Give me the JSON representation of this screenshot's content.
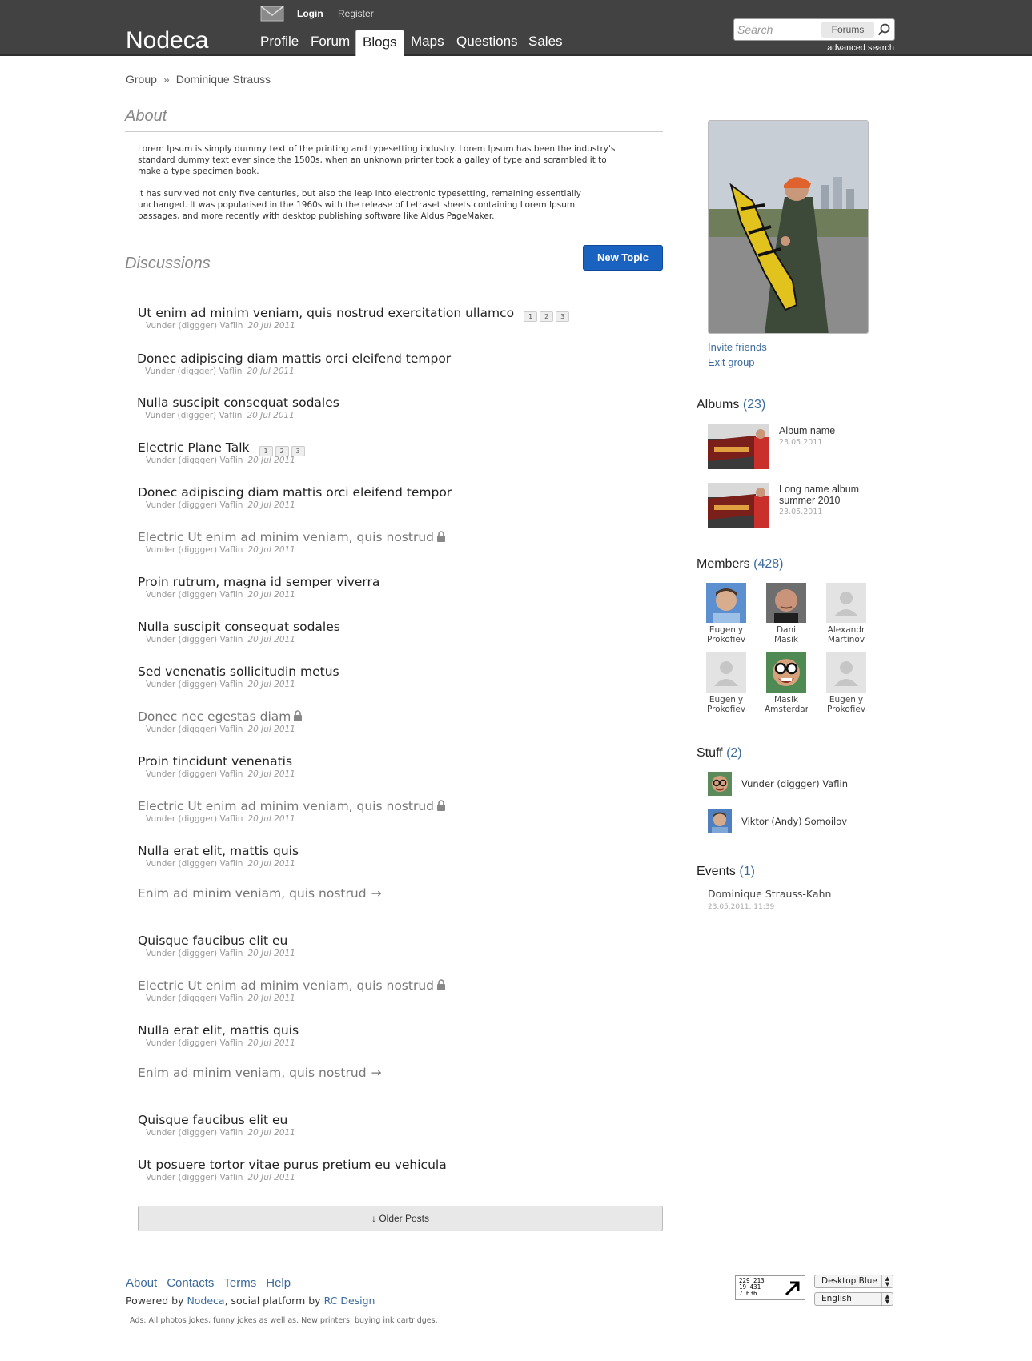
{
  "header": {
    "logo": "Nodeca",
    "login": "Login",
    "register": "Register",
    "nav": [
      "Profile",
      "Forum",
      "Blogs",
      "Maps",
      "Questions",
      "Sales"
    ],
    "active_nav": "Blogs",
    "search_placeholder": "Search",
    "search_scope": "Forums",
    "advanced_search": "advanced search"
  },
  "breadcrumb": {
    "group": "Group",
    "sep": "»",
    "current": "Dominique Strauss"
  },
  "about": {
    "title": "About",
    "p1": "Lorem Ipsum is simply dummy text of the printing and typesetting industry. Lorem Ipsum has been the industry's standard dummy text ever since the 1500s, when an unknown printer took a galley of type and scrambled it to make a type specimen book.",
    "p2": "It has survived not only five centuries, but also the leap into electronic typesetting, remaining essentially unchanged. It was popularised in the 1960s with the release of Letraset sheets containing Lorem Ipsum passages, and more recently with desktop publishing software like Aldus PageMaker."
  },
  "discussions": {
    "title": "Discussions",
    "new_topic": "New Topic",
    "older_posts": "↓ Older Posts",
    "topics": [
      {
        "title": "Ut enim ad minim veniam, quis nostrud exercitation ullamco",
        "author": "Vunder (diggger) Vaflin",
        "date": "20 Jul 2011",
        "pages": [
          "1",
          "2",
          "3"
        ]
      },
      {
        "title": "Donec adipiscing diam mattis orci eleifend tempor",
        "author": "Vunder (diggger) Vaflin",
        "date": "20 Jul 2011"
      },
      {
        "title": "Nulla suscipit consequat sodales",
        "author": "Vunder (diggger) Vaflin",
        "date": "20 Jul 2011"
      },
      {
        "title": "Electric Plane Talk",
        "author": "Vunder (diggger) Vaflin",
        "date": "20 Jul 2011",
        "pages": [
          "1",
          "2",
          "3"
        ]
      },
      {
        "title": "Donec adipiscing diam mattis orci eleifend tempor",
        "author": "Vunder (diggger) Vaflin",
        "date": "20 Jul 2011"
      },
      {
        "title": "Electric Ut enim ad minim veniam, quis nostrud",
        "author": "Vunder (diggger) Vaflin",
        "date": "20 Jul 2011",
        "locked": true
      },
      {
        "title": "Proin rutrum, magna id semper viverra",
        "author": "Vunder (diggger) Vaflin",
        "date": "20 Jul 2011"
      },
      {
        "title": "Nulla suscipit consequat sodales",
        "author": "Vunder (diggger) Vaflin",
        "date": "20 Jul 2011"
      },
      {
        "title": "Sed venenatis sollicitudin metus",
        "author": "Vunder (diggger) Vaflin",
        "date": "20 Jul 2011"
      },
      {
        "title": "Donec nec egestas diam",
        "author": "Vunder (diggger) Vaflin",
        "date": "20 Jul 2011",
        "locked": true
      },
      {
        "title": "Proin tincidunt venenatis",
        "author": "Vunder (diggger) Vaflin",
        "date": "20 Jul 2011"
      },
      {
        "title": "Electric Ut enim ad minim veniam, quis nostrud",
        "author": "Vunder (diggger) Vaflin",
        "date": "20 Jul 2011",
        "locked": true
      },
      {
        "title": "Nulla erat elit, mattis quis",
        "author": "Vunder (diggger) Vaflin",
        "date": "20 Jul 2011"
      },
      {
        "title": "Enim ad minim veniam, quis nostrud",
        "moved": true
      },
      {
        "title": "Quisque faucibus elit eu",
        "author": "Vunder (diggger) Vaflin",
        "date": "20 Jul 2011"
      },
      {
        "title": "Electric Ut enim ad minim veniam, quis nostrud",
        "author": "Vunder (diggger) Vaflin",
        "date": "20 Jul 2011",
        "locked": true
      },
      {
        "title": "Nulla erat elit, mattis quis",
        "author": "Vunder (diggger) Vaflin",
        "date": "20 Jul 2011"
      },
      {
        "title": "Enim ad minim veniam, quis nostrud",
        "moved": true
      },
      {
        "title": "Quisque faucibus elit eu",
        "author": "Vunder (diggger) Vaflin",
        "date": "20 Jul 2011"
      },
      {
        "title": "Ut posuere tortor vitae purus pretium eu vehicula",
        "author": "Vunder (diggger) Vaflin",
        "date": "20 Jul 2011"
      }
    ]
  },
  "sidebar": {
    "invite": "Invite friends",
    "exit": "Exit group",
    "albums": {
      "title": "Albums",
      "count": "(23)",
      "items": [
        {
          "name": "Album name",
          "date": "23.05.2011"
        },
        {
          "name": "Long name album summer 2010",
          "date": "23.05.2011"
        }
      ]
    },
    "members": {
      "title": "Members",
      "count": "(428)",
      "items": [
        {
          "first": "Eugeniy",
          "last": "Prokofiev",
          "avatar": "face-1"
        },
        {
          "first": "Dani",
          "last": "Masik",
          "avatar": "face-2"
        },
        {
          "first": "Alexandr",
          "last": "Martinov",
          "avatar": "placeholder"
        },
        {
          "first": "Eugeniy",
          "last": "Prokofiev",
          "avatar": "placeholder"
        },
        {
          "first": "Masik",
          "last": "Amsterdam",
          "avatar": "face-3"
        },
        {
          "first": "Eugeniy",
          "last": "Prokofiev",
          "avatar": "placeholder"
        }
      ]
    },
    "stuff": {
      "title": "Stuff",
      "count": "(2)",
      "items": [
        {
          "name": "Vunder (diggger) Vaflin"
        },
        {
          "name": "Viktor (Andy) Somoilov"
        }
      ]
    },
    "events": {
      "title": "Events",
      "count": "(1)",
      "items": [
        {
          "name": "Dominique Strauss-Kahn",
          "date": "23.05.2011, 11:39"
        }
      ]
    }
  },
  "footer": {
    "links": [
      "About",
      "Contacts",
      "Terms",
      "Help"
    ],
    "powered_prefix": "Powered by",
    "powered_site": "Nodeca",
    "powered_mid": ", social platform by",
    "powered_company": "RC Design",
    "ads": "Ads: All photos jokes, funny jokes as well as. New printers, buying ink cartridges.",
    "counter": [
      "229 213",
      "19 431",
      "7 636"
    ],
    "theme": "Desktop Blue",
    "language": "English"
  },
  "colors": {
    "header_bg": "#424242",
    "accent": "#1a62c0",
    "link": "#3b6a9c"
  }
}
